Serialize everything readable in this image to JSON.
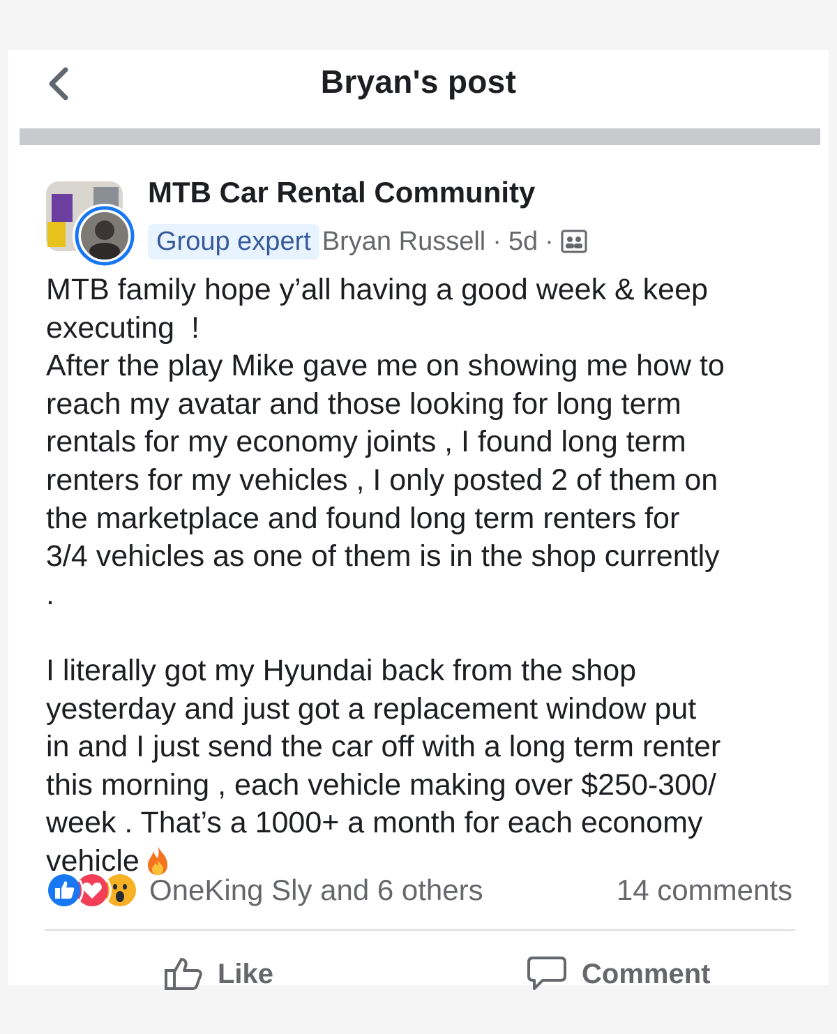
{
  "header": {
    "title": "Bryan's post"
  },
  "post": {
    "group_name": "MTB Car Rental Community",
    "badge": "Group expert",
    "author": "Bryan Russell",
    "time": "5d",
    "separator": "·",
    "body": "MTB family hope y’all having a good week & keep\nexecuting  !\nAfter the play Mike gave me on showing me how to\nreach my avatar and those looking for long term\nrentals for my economy joints , I found long term\nrenters for my vehicles , I only posted 2 of them on\nthe marketplace and found long term renters for\n3/4 vehicles as one of them is in the shop currently\n.\n\nI literally got my Hyundai back from the shop\nyesterday and just got a replacement window put\nin and I just send the car off with a long term renter\nthis morning , each vehicle making over $250-300/\nweek . That’s a 1000+ a month for each economy\nvehicle"
  },
  "reactions": {
    "icons": [
      "like-icon",
      "love-icon",
      "wow-icon"
    ],
    "names": "OneKing Sly and 6 others",
    "comments": "14 comments"
  },
  "actions": {
    "like": "Like",
    "comment": "Comment"
  },
  "colors": {
    "like_blue": "#1877f2",
    "love_red": "#f33e58",
    "wow_yellow": "#f7b125",
    "badge_bg": "#e7f3ff",
    "badge_text": "#385898"
  }
}
